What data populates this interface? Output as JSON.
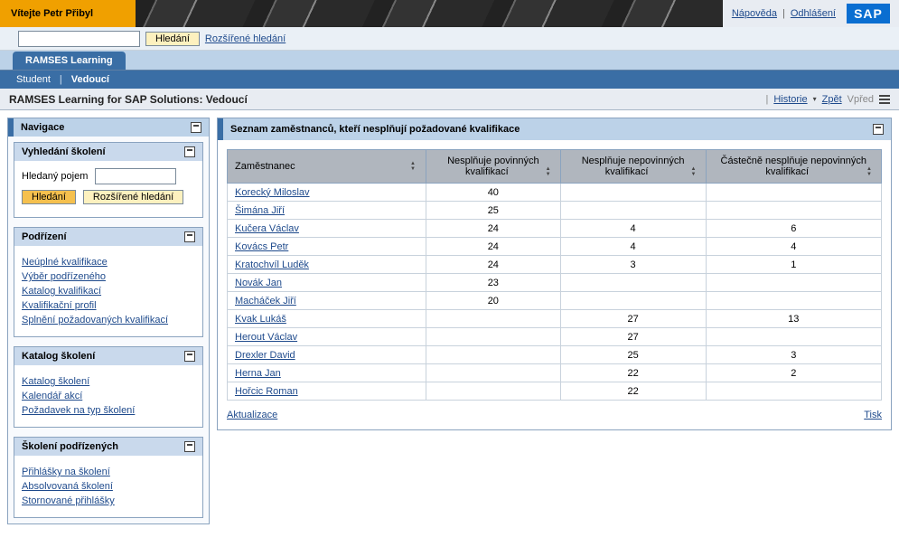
{
  "banner": {
    "welcome": "Vítejte Petr Přibyl",
    "help": "Nápověda",
    "logout": "Odhlášení",
    "logo": "SAP"
  },
  "search": {
    "value": "",
    "button": "Hledání",
    "advanced": "Rozšířené hledání"
  },
  "tabs": {
    "main": "RAMSES Learning",
    "sub": [
      "Student",
      "Vedoucí"
    ],
    "active_sub_index": 1
  },
  "page_title": "RAMSES Learning for SAP Solutions: Vedoucí",
  "page_links": {
    "history": "Historie",
    "back": "Zpět",
    "forward": "Vpřed"
  },
  "nav": {
    "title": "Navigace",
    "search_panel": {
      "title": "Vyhledání školení",
      "label": "Hledaný pojem",
      "btn_search": "Hledání",
      "btn_adv": "Rozšířené hledání"
    },
    "sections": [
      {
        "title": "Podřízení",
        "links": [
          "Neúplné kvalifikace",
          "Výběr podřízeného",
          "Katalog kvalifikací",
          "Kvalifikační profil",
          "Splnění požadovaných kvalifikací"
        ]
      },
      {
        "title": "Katalog školení",
        "links": [
          "Katalog školení",
          "Kalendář akcí",
          "Požadavek na typ školení"
        ]
      },
      {
        "title": "Školení podřízených",
        "links": [
          "Přihlášky na školení",
          "Absolvovaná školení",
          "Stornované přihlášky"
        ]
      }
    ]
  },
  "main": {
    "title": "Seznam zaměstnanců, kteří nesplňují požadované kvalifikace",
    "columns": [
      "Zaměstnanec",
      "Nesplňuje povinných kvalifikací",
      "Nesplňuje nepovinných kvalifikací",
      "Částečně nesplňuje nepovinných kvalifikací"
    ],
    "rows": [
      {
        "name": "Korecký Miloslav",
        "c1": "40",
        "c2": "",
        "c3": ""
      },
      {
        "name": "Šimána Jiří",
        "c1": "25",
        "c2": "",
        "c3": ""
      },
      {
        "name": "Kučera Václav",
        "c1": "24",
        "c2": "4",
        "c3": "6"
      },
      {
        "name": "Kovács Petr",
        "c1": "24",
        "c2": "4",
        "c3": "4"
      },
      {
        "name": "Kratochvíl Luděk",
        "c1": "24",
        "c2": "3",
        "c3": "1"
      },
      {
        "name": "Novák Jan",
        "c1": "23",
        "c2": "",
        "c3": ""
      },
      {
        "name": "Macháček Jiří",
        "c1": "20",
        "c2": "",
        "c3": ""
      },
      {
        "name": "Kvak Lukáš",
        "c1": "",
        "c2": "27",
        "c3": "13"
      },
      {
        "name": "Herout Václav",
        "c1": "",
        "c2": "27",
        "c3": ""
      },
      {
        "name": "Drexler David",
        "c1": "",
        "c2": "25",
        "c3": "3"
      },
      {
        "name": "Herna Jan",
        "c1": "",
        "c2": "22",
        "c3": "2"
      },
      {
        "name": "Hořcic Roman",
        "c1": "",
        "c2": "22",
        "c3": ""
      }
    ],
    "footer": {
      "refresh": "Aktualizace",
      "print": "Tisk"
    }
  }
}
